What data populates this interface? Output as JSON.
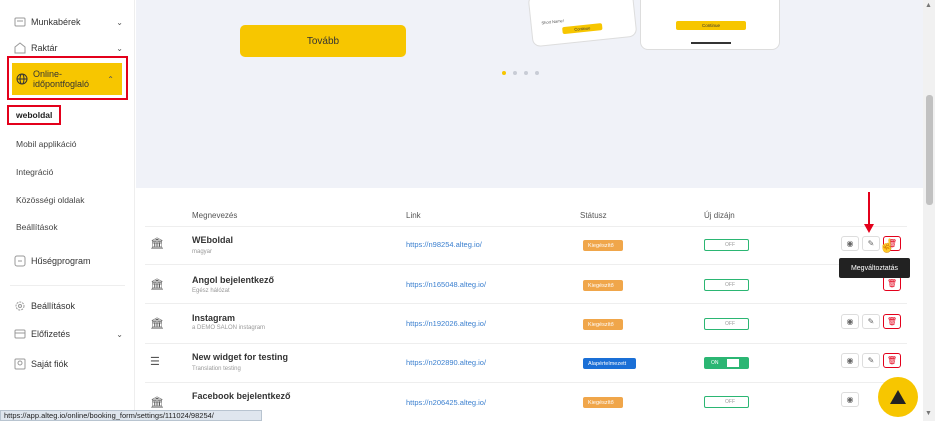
{
  "sidebar": {
    "items": [
      {
        "label": "Munkabérek",
        "icon": "payroll-icon"
      },
      {
        "label": "Raktár",
        "icon": "warehouse-icon"
      },
      {
        "label": "Online-időpontfoglaló",
        "icon": "globe-icon"
      }
    ],
    "online_line1": "Online-",
    "online_line2": "időpontfoglaló",
    "sub_items": [
      "weboldal",
      "Mobil applikáció",
      "Integráció",
      "Közösségi oldalak",
      "Beállítások"
    ],
    "loyalty": "Hűségprogram",
    "settings": "Beállítások",
    "subscription": "Előfizetés",
    "account": "Saját fiók"
  },
  "hero": {
    "button": "Tovább",
    "phone_left_hint": "Short Name!",
    "phone_left_btn": "Continue",
    "phone_right_btn": "Continue"
  },
  "table": {
    "headers": {
      "name": "Megnevezés",
      "link": "Link",
      "status": "Státusz",
      "new_design": "Új dizájn"
    },
    "rows": [
      {
        "name": "WEboldal",
        "sub": "magyar",
        "link": "https://n98254.alteg.io/",
        "status": "Kiegészítő",
        "toggle": "OFF"
      },
      {
        "name": "Angol bejelentkező",
        "sub": "Egész hálózat",
        "link": "https://n165048.alteg.io/",
        "status": "Kiegészítő",
        "toggle": "OFF"
      },
      {
        "name": "Instagram",
        "sub": "a DEMO SALON instagram",
        "link": "https://n192026.alteg.io/",
        "status": "Kiegészítő",
        "toggle": "OFF"
      },
      {
        "name": "New widget for testing",
        "sub": "Translation testing",
        "link": "https://n202890.alteg.io/",
        "status": "Alapértelmezett",
        "toggle": "ON"
      },
      {
        "name": "Facebook bejelentkező",
        "sub": "",
        "link": "https://n206425.alteg.io/",
        "status": "Kiegészítő",
        "toggle": "OFF"
      }
    ]
  },
  "tooltip": "Megváltoztatás",
  "status_url": "https://app.alteg.io/online/booking_form/settings/111024/98254/",
  "colors": {
    "accent": "#f7c600",
    "highlight": "#e3001b",
    "link": "#3a7fcf",
    "badge_orange": "#f0a64a",
    "badge_blue": "#1a6fd6",
    "toggle_green": "#2bb673"
  }
}
